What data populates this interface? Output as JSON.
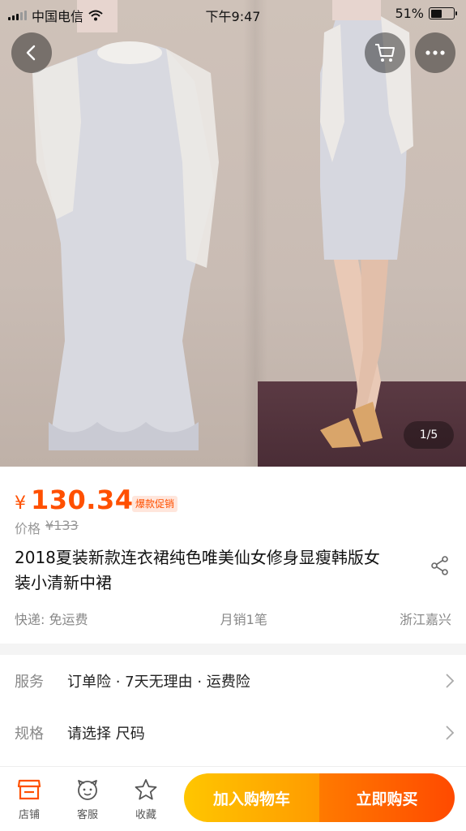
{
  "status_bar": {
    "carrier": "中国电信",
    "time": "下午9:47",
    "battery": "51%",
    "battery_level": 0.51
  },
  "gallery": {
    "counter": "1/5"
  },
  "product": {
    "currency": "¥",
    "price": "130.34",
    "promo_tag": "爆款促销",
    "orig_label": "价格",
    "orig_price": "¥133",
    "title": "2018夏装新款连衣裙纯色唯美仙女修身显瘦韩版女装小清新中裙",
    "shipping": "快递: 免运费",
    "monthly_sales": "月销1笔",
    "location": "浙江嘉兴"
  },
  "service": {
    "label": "服务",
    "value": "订单险 · 7天无理由 · 运费险"
  },
  "spec": {
    "label": "规格",
    "value": "请选择 尺码"
  },
  "bottom_bar": {
    "store": "店铺",
    "support": "客服",
    "favorite": "收藏",
    "add_to_cart": "加入购物车",
    "buy_now": "立即购买"
  },
  "colors": {
    "accent": "#ff5000",
    "cart_gradient": [
      "#ffc600",
      "#ff9b00"
    ],
    "buy_gradient": [
      "#ff7a00",
      "#ff4a00"
    ]
  },
  "icons": [
    "back-icon",
    "cart-icon",
    "more-icon",
    "share-icon",
    "chevron-right-icon",
    "store-icon",
    "support-icon",
    "star-icon"
  ]
}
